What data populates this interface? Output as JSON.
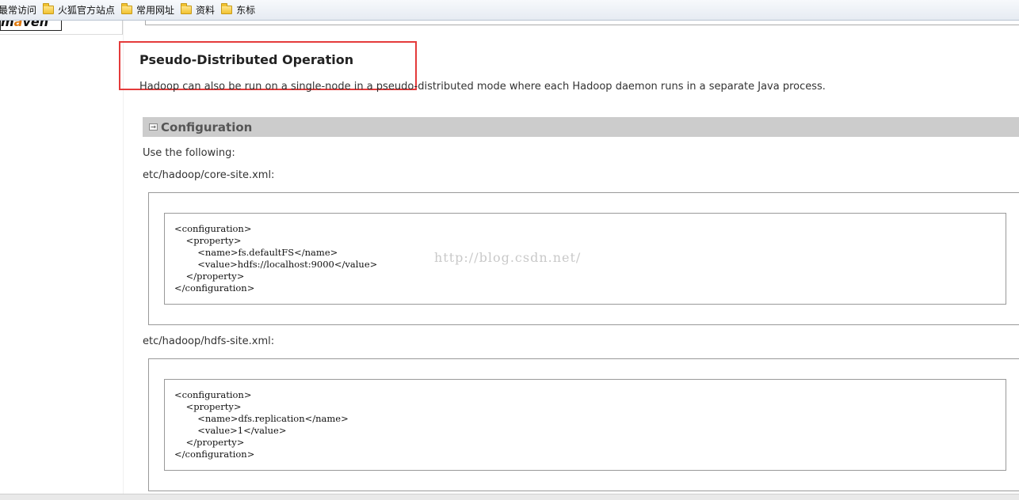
{
  "bookmarks": [
    {
      "label": "最常访问",
      "icon": "none"
    },
    {
      "label": "火狐官方站点",
      "icon": "folder-icon"
    },
    {
      "label": "常用网址",
      "icon": "folder-icon"
    },
    {
      "label": "资料",
      "icon": "folder-icon"
    },
    {
      "label": "东标",
      "icon": "folder-icon"
    }
  ],
  "sidebar": {
    "logo_text_pre": "m",
    "logo_text_a": "a",
    "logo_text_post": "ven"
  },
  "main": {
    "title": "Pseudo-Distributed Operation",
    "intro": "Hadoop can also be run on a single-node in a pseudo-distributed mode where each Hadoop daemon runs in a separate Java process.",
    "section": {
      "title": "Configuration",
      "expand_symbol": "→"
    },
    "use_following": "Use the following:",
    "core_site_label": "etc/hadoop/core-site.xml:",
    "core_site_code": "<configuration>\n    <property>\n        <name>fs.defaultFS</name>\n        <value>hdfs://localhost:9000</value>\n    </property>\n</configuration>",
    "hdfs_site_label": "etc/hadoop/hdfs-site.xml:",
    "hdfs_site_code": "<configuration>\n    <property>\n        <name>dfs.replication</name>\n        <value>1</value>\n    </property>\n</configuration>",
    "watermark": "http://blog.csdn.net/"
  },
  "colors": {
    "highlight_box": "#e43b3b",
    "section_bar": "#cccccc"
  }
}
